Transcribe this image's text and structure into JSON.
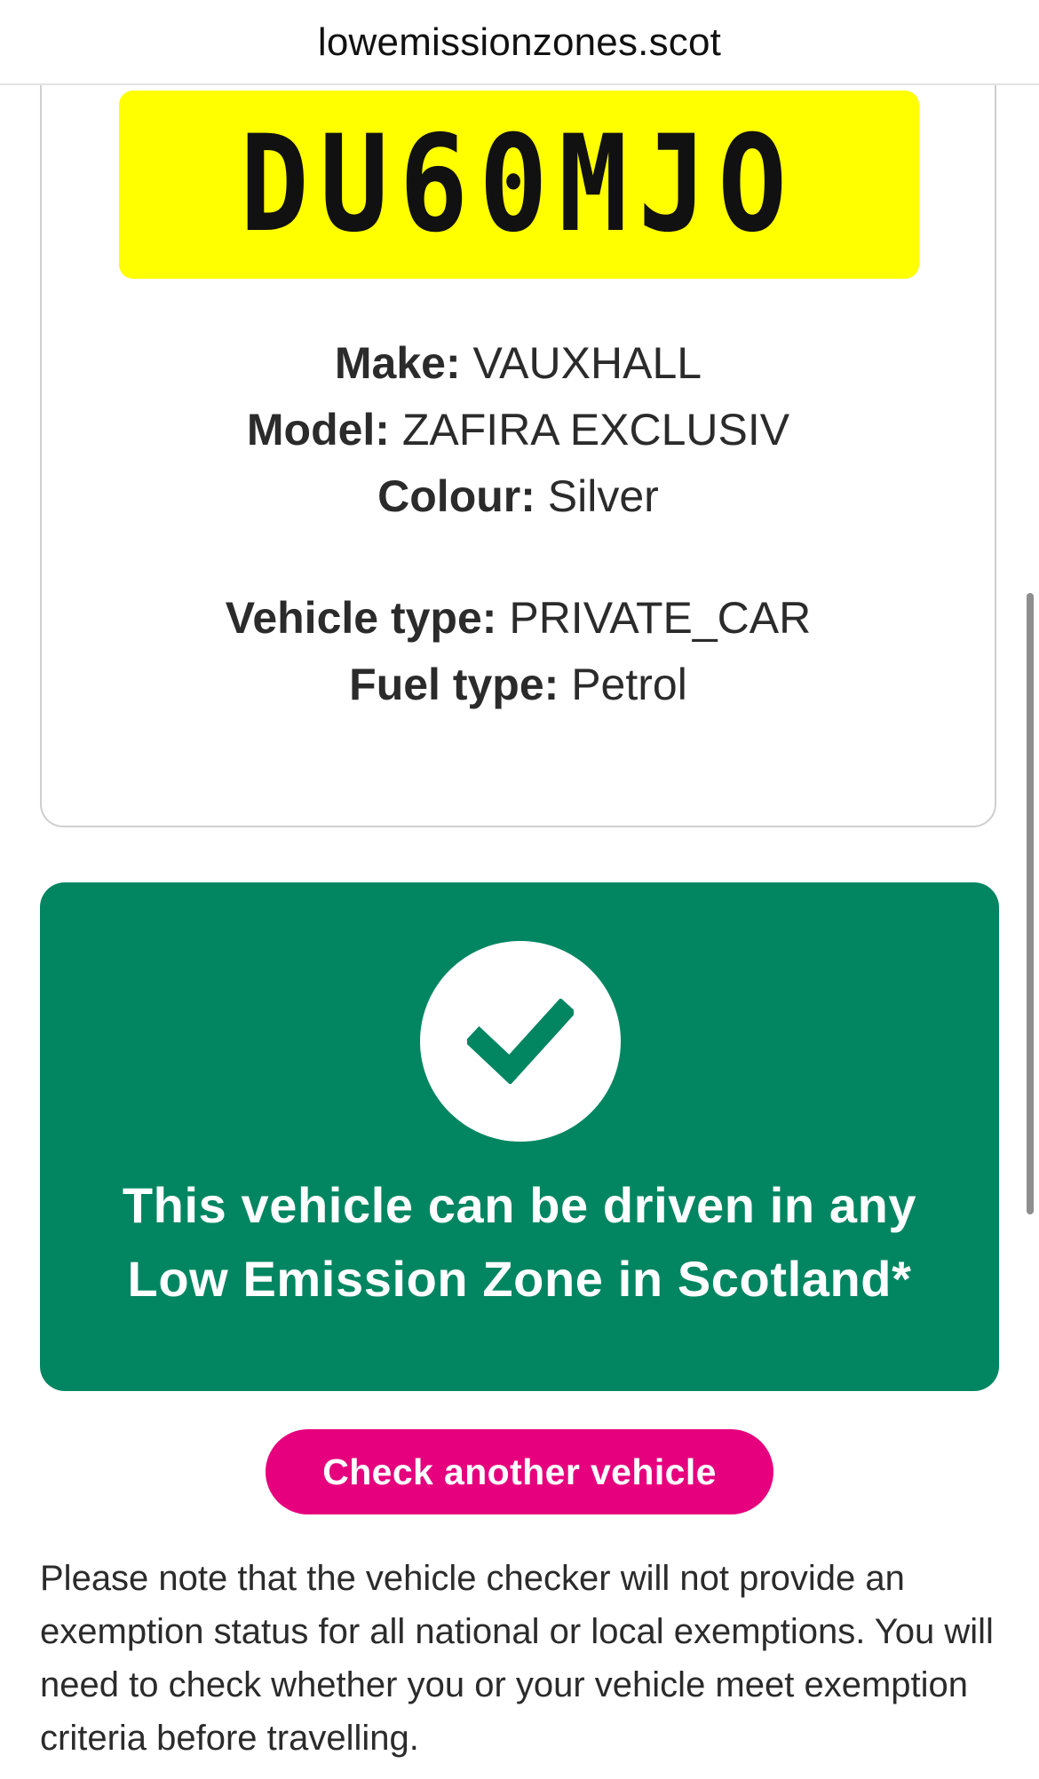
{
  "browser": {
    "url": "lowemissionzones.scot"
  },
  "vehicle": {
    "registration": "DU60MJO",
    "make_label": "Make:",
    "make": "VAUXHALL",
    "model_label": "Model:",
    "model": "ZAFIRA EXCLUSIV",
    "colour_label": "Colour:",
    "colour": "Silver",
    "vehicle_type_label": "Vehicle type:",
    "vehicle_type": "PRIVATE_CAR",
    "fuel_type_label": "Fuel type:",
    "fuel_type": "Petrol"
  },
  "result": {
    "line1": "This vehicle can be driven in any",
    "line2": "Low Emission Zone in Scotland*",
    "icon": "checkmark-icon",
    "color": "#028661"
  },
  "actions": {
    "check_another_label": "Check another vehicle",
    "button_color": "#e6007e"
  },
  "note": {
    "text": "Please note that the vehicle checker will not provide an exemption status for all national or local exemptions. You will need to check whether you or your vehicle meet exemption criteria before travelling."
  },
  "plate_color": "#ffff00"
}
